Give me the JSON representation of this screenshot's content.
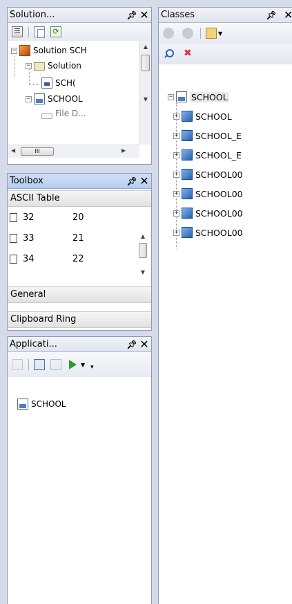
{
  "solution_explorer": {
    "title": "Solution...",
    "tree": [
      "Solution SCH",
      "Solution",
      "SCH(",
      "SCHOOL",
      "File D..."
    ],
    "hscroll_label": "III"
  },
  "toolbox": {
    "title": "Toolbox",
    "categories": [
      "ASCII Table",
      "General",
      "Clipboard Ring"
    ],
    "ascii_rows": [
      {
        "dec": "32",
        "hex": "20"
      },
      {
        "dec": "33",
        "hex": "21"
      },
      {
        "dec": "34",
        "hex": "22"
      }
    ]
  },
  "application": {
    "title": "Applicati...",
    "tree": [
      "SCHOOL"
    ]
  },
  "classes": {
    "title": "Classes",
    "root": "SCHOOL",
    "items": [
      "SCHOOL",
      "SCHOOL_E",
      "SCHOOL_E",
      "SCHOOL00",
      "SCHOOL00",
      "SCHOOL00",
      "SCHOOL00"
    ]
  },
  "colors": {
    "active_title": "#b6cfee",
    "inactive_title": "#e8ecf3",
    "border": "#8e9bb5"
  }
}
